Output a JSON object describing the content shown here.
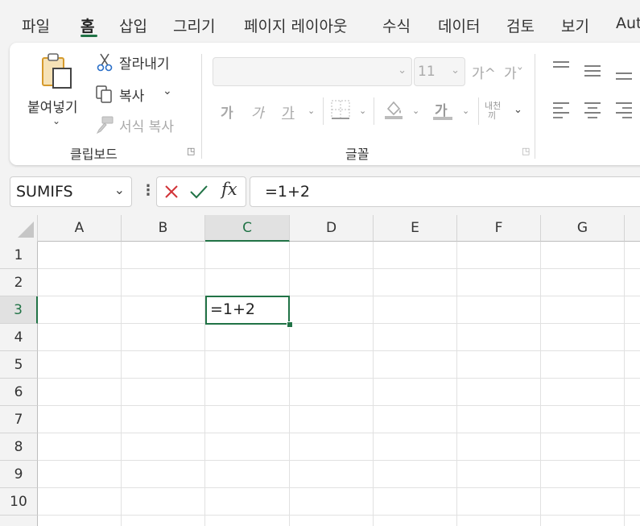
{
  "tabs": [
    "파일",
    "홈",
    "삽입",
    "그리기",
    "페이지 레이아웃",
    "수식",
    "데이터",
    "검토",
    "보기",
    "Aut"
  ],
  "active_tab": "홈",
  "clipboard": {
    "paste_label": "붙여넣기",
    "cut_label": "잘라내기",
    "copy_label": "복사",
    "format_painter_label": "서식 복사",
    "group_label": "클립보드"
  },
  "font": {
    "font_name": "",
    "font_size": "11",
    "increase_size": "가^",
    "decrease_size": "가ˇ",
    "bold": "가",
    "italic": "가",
    "underline": "가",
    "font_color": "가",
    "phonetic_top": "내천",
    "phonetic_bottom": "끼",
    "group_label": "글꼴"
  },
  "formula_bar": {
    "name_box": "SUMIFS",
    "formula": "=1+2",
    "fx_label": "fx"
  },
  "grid": {
    "columns": [
      "A",
      "B",
      "C",
      "D",
      "E",
      "F",
      "G"
    ],
    "rows": [
      "1",
      "2",
      "3",
      "4",
      "5",
      "6",
      "7",
      "8",
      "9",
      "10"
    ],
    "selected_column": "C",
    "selected_row": "3",
    "active_cell_value": "=1+2"
  },
  "colors": {
    "accent": "#217346",
    "cancel": "#d13438",
    "enter": "#217346"
  }
}
